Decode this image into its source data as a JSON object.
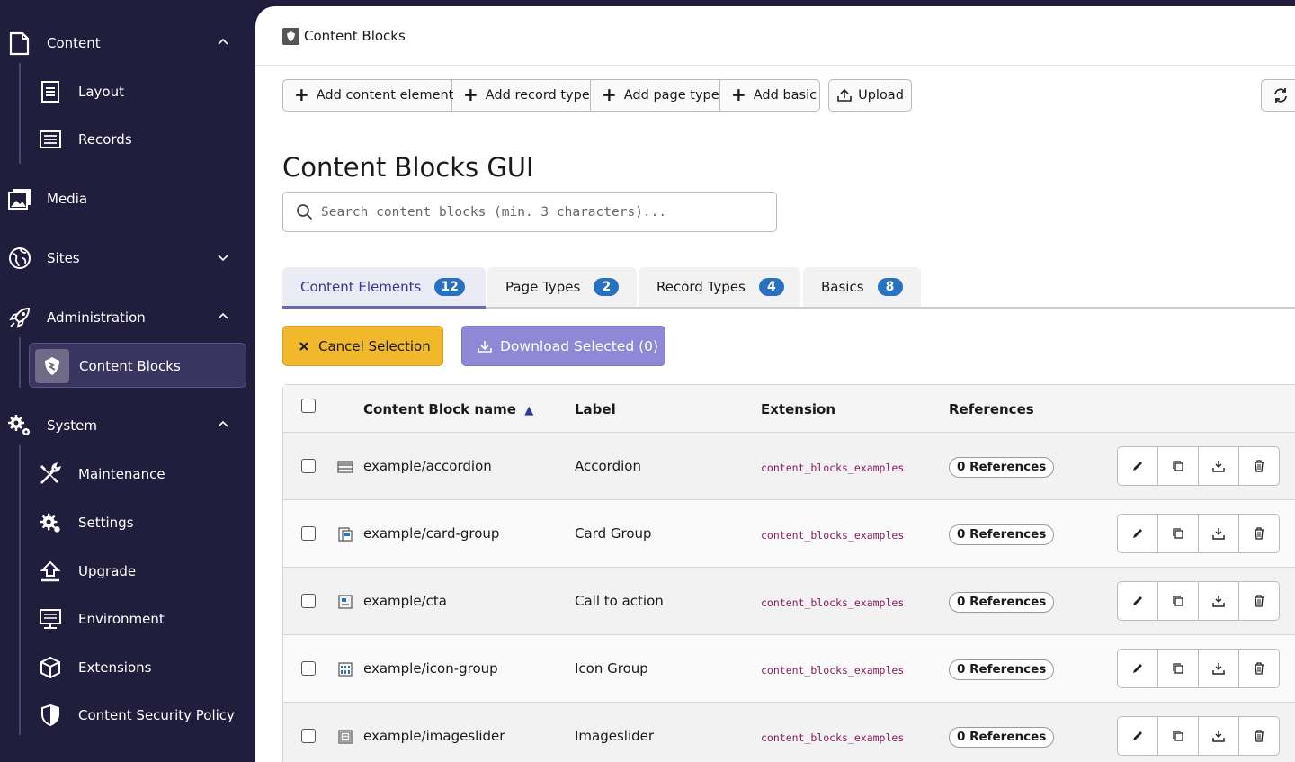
{
  "sidebar": {
    "groups": {
      "content": "Content",
      "media": "Media",
      "sites": "Sites",
      "administration": "Administration",
      "system": "System"
    },
    "items": {
      "layout": "Layout",
      "records": "Records",
      "content_blocks": "Content Blocks",
      "maintenance": "Maintenance",
      "settings": "Settings",
      "upgrade": "Upgrade",
      "environment": "Environment",
      "extensions": "Extensions",
      "csp": "Content Security Policy"
    }
  },
  "header": {
    "title": "Content Blocks"
  },
  "toolbar": {
    "add_content_element": "Add content element",
    "add_record_type": "Add record type",
    "add_page_type": "Add page type",
    "add_basic": "Add basic",
    "upload": "Upload"
  },
  "page": {
    "title": "Content Blocks GUI",
    "search_placeholder": "Search content blocks (min. 3 characters)..."
  },
  "tabs": [
    {
      "label": "Content Elements",
      "count": "12"
    },
    {
      "label": "Page Types",
      "count": "2"
    },
    {
      "label": "Record Types",
      "count": "4"
    },
    {
      "label": "Basics",
      "count": "8"
    }
  ],
  "selection": {
    "cancel": "Cancel Selection",
    "download": "Download Selected (0)"
  },
  "table": {
    "headers": {
      "name": "Content Block name",
      "sort_indicator": "▲",
      "label": "Label",
      "extension": "Extension",
      "references": "References"
    },
    "rows": [
      {
        "name": "example/accordion",
        "label": "Accordion",
        "extension": "content_blocks_examples",
        "references": "0 References"
      },
      {
        "name": "example/card-group",
        "label": "Card Group",
        "extension": "content_blocks_examples",
        "references": "0 References"
      },
      {
        "name": "example/cta",
        "label": "Call to action",
        "extension": "content_blocks_examples",
        "references": "0 References"
      },
      {
        "name": "example/icon-group",
        "label": "Icon Group",
        "extension": "content_blocks_examples",
        "references": "0 References"
      },
      {
        "name": "example/imageslider",
        "label": "Imageslider",
        "extension": "content_blocks_examples",
        "references": "0 References"
      }
    ]
  },
  "colors": {
    "sidebar_bg": "#211d3d",
    "accent": "#6c68b8",
    "badge": "#2671c2",
    "warning": "#f2b82c",
    "extension_text": "#8a1c5c"
  }
}
